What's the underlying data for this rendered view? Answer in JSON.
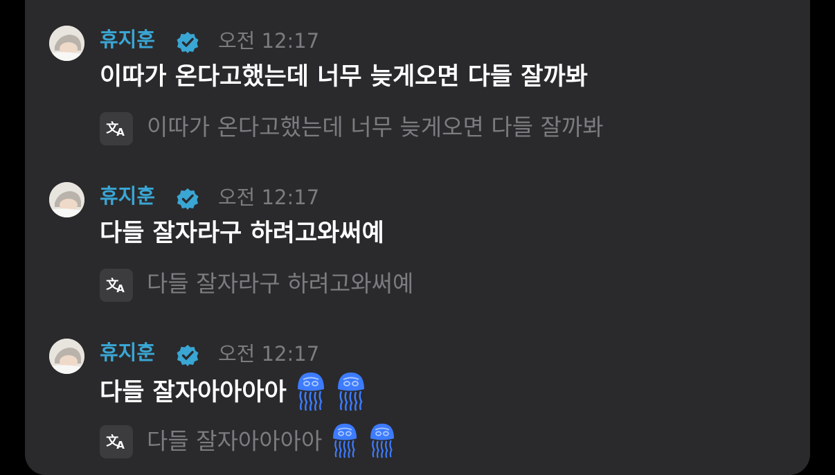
{
  "messages": [
    {
      "author": "휴지훈",
      "time": "오전 12:17",
      "text": "이따가 온다고했는데 너무 늦게오면 다들 잘까봐",
      "translation": "이따가 온다고했는데 너무 늦게오면 다들 잘까봐",
      "emoji": []
    },
    {
      "author": "휴지훈",
      "time": "오전 12:17",
      "text": "다들 잘자라구 하려고와써예",
      "translation": "다들 잘자라구 하려고와써예",
      "emoji": []
    },
    {
      "author": "휴지훈",
      "time": "오전 12:17",
      "text": "다들 잘자아아아아",
      "translation": "다들 잘자아아아아",
      "emoji": [
        "jellyfish-icon",
        "jellyfish-icon"
      ]
    }
  ],
  "colors": {
    "panel": "#2a2a2c",
    "author": "#3aa6d4",
    "verified": "#3aa6d4",
    "muted": "#7c7c80",
    "jellyfish": "#3d7bff"
  }
}
